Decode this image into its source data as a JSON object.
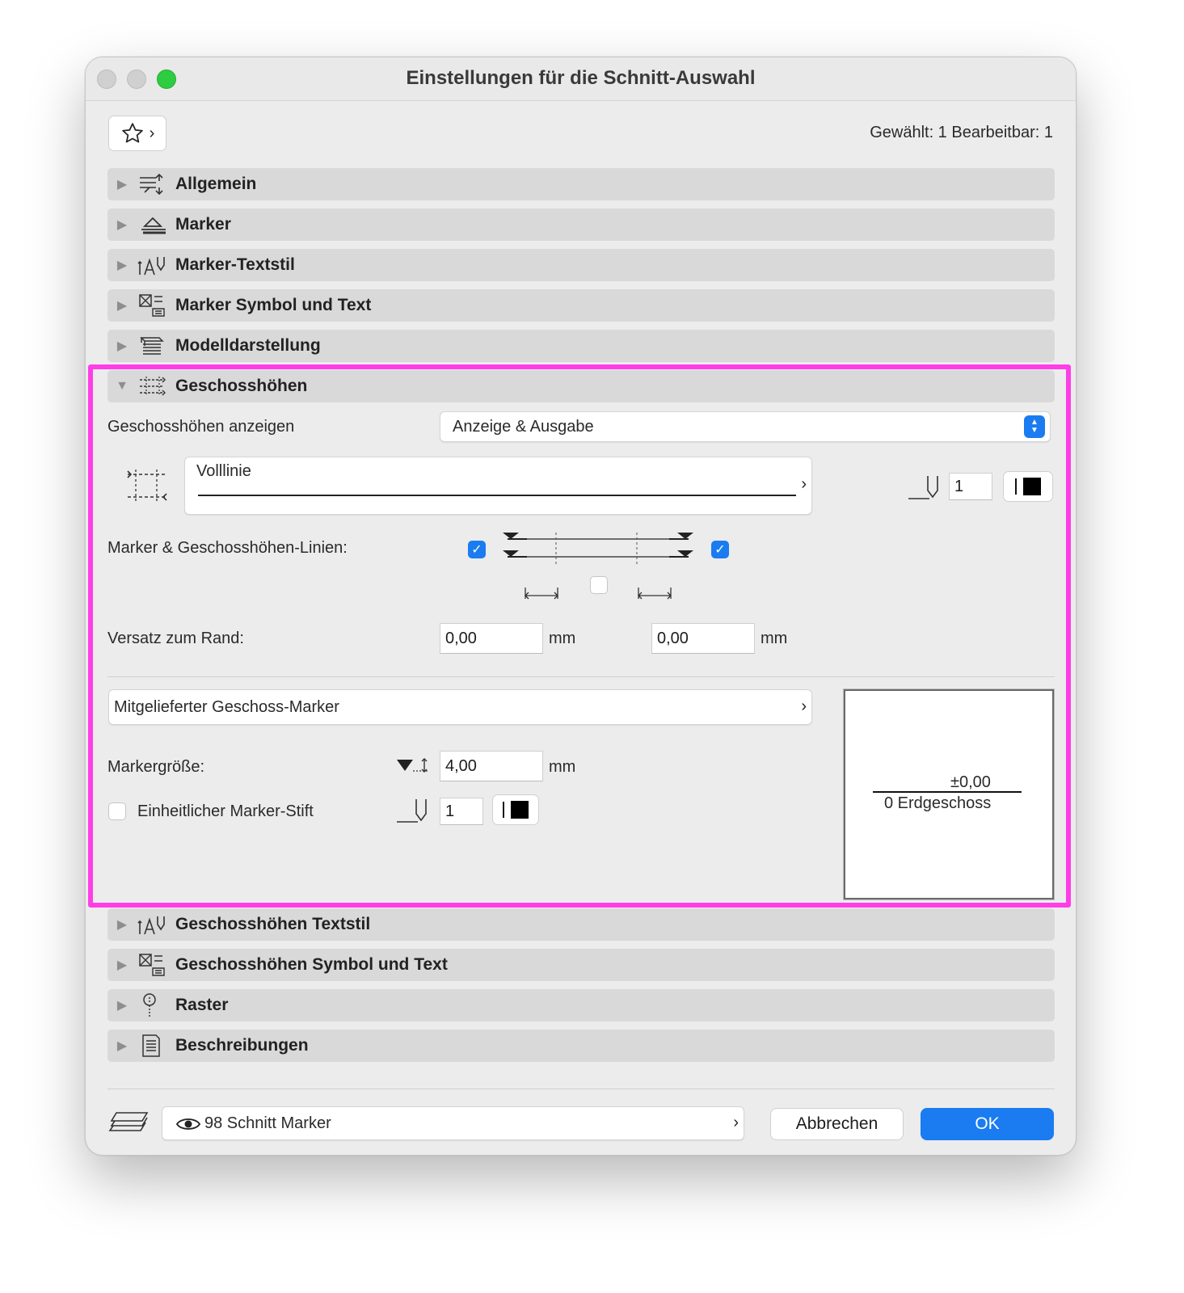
{
  "window": {
    "title": "Einstellungen für die Schnitt-Auswahl"
  },
  "header": {
    "selection_info": "Gewählt: 1 Bearbeitbar: 1"
  },
  "sections": [
    {
      "label": "Allgemein",
      "icon": "general-settings-icon"
    },
    {
      "label": "Marker",
      "icon": "marker-icon"
    },
    {
      "label": "Marker-Textstil",
      "icon": "text-style-icon"
    },
    {
      "label": "Marker Symbol und Text",
      "icon": "symbol-text-icon"
    },
    {
      "label": "Modelldarstellung",
      "icon": "model-display-icon"
    },
    {
      "label": "Geschosshöhen",
      "icon": "story-levels-icon"
    },
    {
      "label": "Geschosshöhen Textstil",
      "icon": "text-style-icon"
    },
    {
      "label": "Geschosshöhen Symbol und Text",
      "icon": "symbol-text-icon"
    },
    {
      "label": "Raster",
      "icon": "grid-icon"
    },
    {
      "label": "Beschreibungen",
      "icon": "description-icon"
    }
  ],
  "story_levels": {
    "show_label": "Geschosshöhen anzeigen",
    "show_value": "Anzeige & Ausgabe",
    "line_type": "Volllinie",
    "pen_number": "1",
    "lines_label": "Marker & Geschosshöhen-Linien:",
    "left_checked": true,
    "right_checked": true,
    "middle_checked": false,
    "offset_label": "Versatz zum Rand:",
    "offset_left": "0,00",
    "offset_right": "0,00",
    "unit": "mm",
    "marker_type": "Mitgelieferter Geschoss-Marker",
    "marker_size_label": "Markergröße:",
    "marker_size": "4,00",
    "uniform_pen_label": "Einheitlicher Marker-Stift",
    "uniform_pen_checked": false,
    "marker_pen_number": "1",
    "preview_value": "±0,00",
    "preview_name": "0 Erdgeschoss"
  },
  "footer": {
    "layer_value": "98 Schnitt Marker",
    "cancel": "Abbrechen",
    "ok": "OK"
  },
  "colors": {
    "accent": "#1a7cf0",
    "highlight": "#ff3ee8",
    "pen_color": "#000000"
  }
}
